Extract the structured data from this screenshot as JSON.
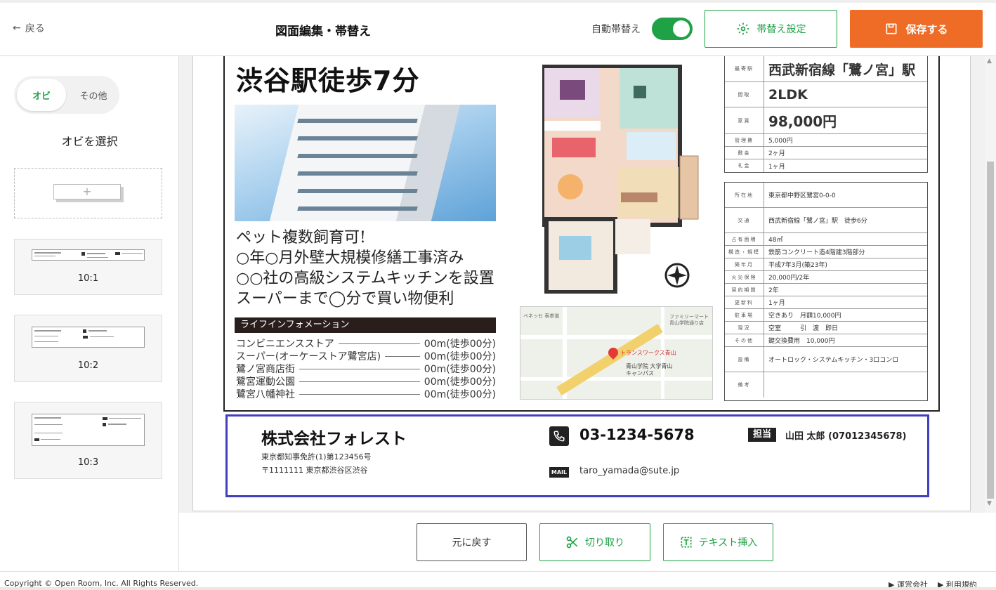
{
  "header": {
    "back_label": "戻る",
    "title": "図面編集・帯替え",
    "auto_obi_label": "自動帯替え",
    "auto_obi_on": true,
    "obi_settings_label": "帯替え設定",
    "save_label": "保存する",
    "accent_green": "#1fa145",
    "accent_orange": "#ef6c26"
  },
  "sidebar": {
    "tabs": [
      {
        "label": "オビ",
        "active": true
      },
      {
        "label": "その他",
        "active": false
      }
    ],
    "section_title": "オビを選択",
    "templates": [
      {
        "label": "10:1",
        "company": "株式会社フォレスト",
        "phone": "03-1234-5678"
      },
      {
        "label": "10:2",
        "company": "株式会社フォレスト",
        "phone": "03-1234-5678"
      },
      {
        "label": "10:3",
        "company": "株式会社フォレスト",
        "phone": "03-1234-5678"
      }
    ]
  },
  "flyer": {
    "headline": "渋谷駅徒歩7分",
    "features": [
      "ペット複数飼育可!",
      "○年○月外壁大規模修繕工事済み",
      "○○社の高級システムキッチンを設置",
      "スーパーまで◯分で買い物便利"
    ],
    "lifeinfo_title": "ライフインフォメーション",
    "lifeinfo": [
      {
        "name": "コンビニエンスストア",
        "dist": "00m(徒歩00分)"
      },
      {
        "name": "スーパー(オーケーストア鷺宮店)",
        "dist": "00m(徒歩00分)"
      },
      {
        "name": "鷺ノ宮商店街",
        "dist": "00m(徒歩00分)"
      },
      {
        "name": "鷺宮運動公園",
        "dist": "00m(徒歩00分)"
      },
      {
        "name": "鷺宮八幡神社",
        "dist": "00m(徒歩00分)"
      }
    ],
    "map": {
      "pin_label": "トランスワークス青山",
      "poi": "青山学院 大学青山 キャンパス",
      "shop": "ファミリーマート 青山学院通り店",
      "station": "ベネッセ 表参道"
    },
    "spec_top": [
      {
        "label": "最寄駅",
        "value": "西武新宿線「鷺ノ宮」駅",
        "size": "big"
      },
      {
        "label": "間取",
        "value": "2LDK",
        "size": "big"
      },
      {
        "label": "家賃",
        "value": "98,000円",
        "size": "big"
      },
      {
        "label": "管理費",
        "value": "5,000円",
        "size": "small"
      },
      {
        "label": "敷金",
        "value": "2ヶ月",
        "size": "small"
      },
      {
        "label": "礼金",
        "value": "1ヶ月",
        "size": "small"
      }
    ],
    "spec_bottom": [
      {
        "label": "所在地",
        "value": "東京都中野区鷺宮0-0-0",
        "h": 36
      },
      {
        "label": "交通",
        "value": "西武新宿線「鷺ノ宮」駅　徒歩6分",
        "h": 36
      },
      {
        "label": "占有面積",
        "value": "48㎡",
        "h": 18
      },
      {
        "label": "構造・規模",
        "value": "鉄筋コンクリート造4階建3階部分",
        "h": 18
      },
      {
        "label": "築年月",
        "value": "平成7年3月(築23年)",
        "h": 18
      },
      {
        "label": "火災保険",
        "value": "20,000円/2年",
        "h": 18
      },
      {
        "label": "契約期間",
        "value": "2年",
        "h": 18
      },
      {
        "label": "更新料",
        "value": "1ヶ月",
        "h": 18
      },
      {
        "label": "駐車場",
        "value": "空きあり　月額10,000円",
        "h": 18
      },
      {
        "label": "現況",
        "value": "空室　　　引　渡　即日",
        "h": 18
      },
      {
        "label": "その他",
        "value": "鍵交換費用　10,000円",
        "h": 18
      },
      {
        "label": "設備",
        "value": "オートロック・システムキッチン・3口コンロ",
        "h": 36
      },
      {
        "label": "備考",
        "value": "",
        "h": 36
      }
    ]
  },
  "contact": {
    "company": "株式会社フォレスト",
    "license": "東京都知事免許(1)第123456号",
    "address": "〒1111111 東京都渋谷区渋谷",
    "phone": "03-1234-5678",
    "mail_badge": "MAIL",
    "email": "taro_yamada@sute.jp",
    "person_badge": "担当",
    "person": "山田 太郎 (07012345678)",
    "frame_color": "#3f3fc0"
  },
  "toolbar": {
    "undo_label": "元に戻す",
    "cut_label": "切り取り",
    "text_insert_label": "テキスト挿入"
  },
  "footer": {
    "copyright": "Copyright © Open Room, Inc. All Rights Reserved.",
    "links": [
      "▶ 運営会社",
      "▶ 利用規約"
    ]
  }
}
